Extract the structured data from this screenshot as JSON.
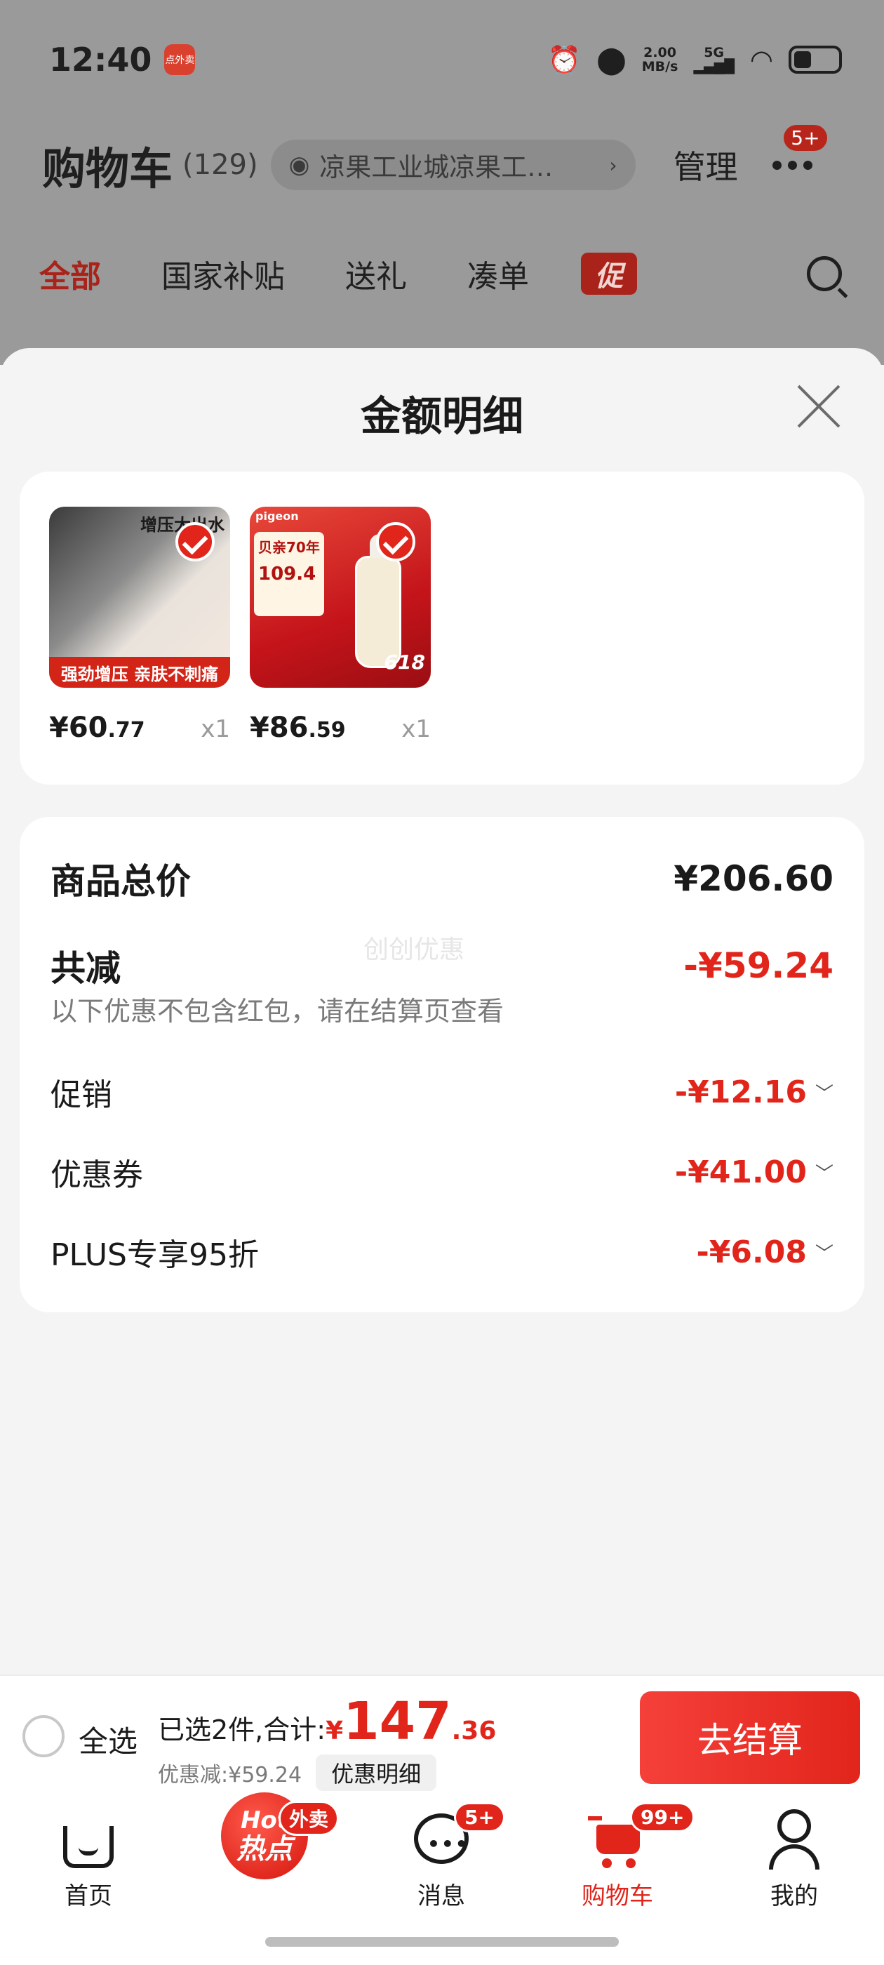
{
  "status_bar": {
    "time": "12:40",
    "app_icon_label": "点外卖",
    "net_speed_value": "2.00",
    "net_speed_unit": "MB/s",
    "signal_label": "5G"
  },
  "cart_header": {
    "title": "购物车",
    "count": "(129)",
    "address": "凉果工业城凉果工…",
    "manage_label": "管理",
    "more_badge": "5+"
  },
  "filter_tabs": [
    {
      "label": "全部",
      "active": true
    },
    {
      "label": "国家补贴",
      "active": false
    },
    {
      "label": "送礼",
      "active": false
    },
    {
      "label": "凑单",
      "active": false
    }
  ],
  "promo_tab_label": "促",
  "sheet": {
    "title": "金额明细",
    "products": [
      {
        "price_int": "¥60",
        "price_dec": ".77",
        "qty": "x1",
        "thumb_title": "增压大出水",
        "thumb_band": "强劲增压 亲肤不刺痛"
      },
      {
        "price_int": "¥86",
        "price_dec": ".59",
        "qty": "x1",
        "thumb_logo": "pigeon",
        "thumb_headline": "贝亲70年",
        "thumb_price": "109.4",
        "thumb_tag": "618"
      }
    ],
    "summary": {
      "goods_total_label": "商品总价",
      "goods_total_value": "¥206.60",
      "reduction_label": "共减",
      "reduction_value": "-¥59.24",
      "note": "以下优惠不包含红包，请在结算页查看",
      "watermark": "创创优惠",
      "items": [
        {
          "label": "促销",
          "value": "-¥12.16"
        },
        {
          "label": "优惠券",
          "value": "-¥41.00"
        },
        {
          "label": "PLUS专享95折",
          "value": "-¥6.08"
        }
      ]
    }
  },
  "checkout": {
    "select_all_label": "全选",
    "selected_text": "已选2件,合计:",
    "total_currency": "¥",
    "total_int": "147",
    "total_dec": ".36",
    "discount_text": "优惠减:¥59.24",
    "detail_chip_label": "优惠明细",
    "checkout_button_label": "去结算"
  },
  "bottom_nav": [
    {
      "label": "首页",
      "badge": ""
    },
    {
      "label": "热点",
      "badge": "外卖",
      "hot_text": "Hot"
    },
    {
      "label": "消息",
      "badge": "5+"
    },
    {
      "label": "购物车",
      "badge": "99+"
    },
    {
      "label": "我的",
      "badge": ""
    }
  ],
  "colors": {
    "accent_red": "#e1251b",
    "overlay_gray": "#9a9a9a",
    "sheet_bg": "#f4f4f5"
  }
}
